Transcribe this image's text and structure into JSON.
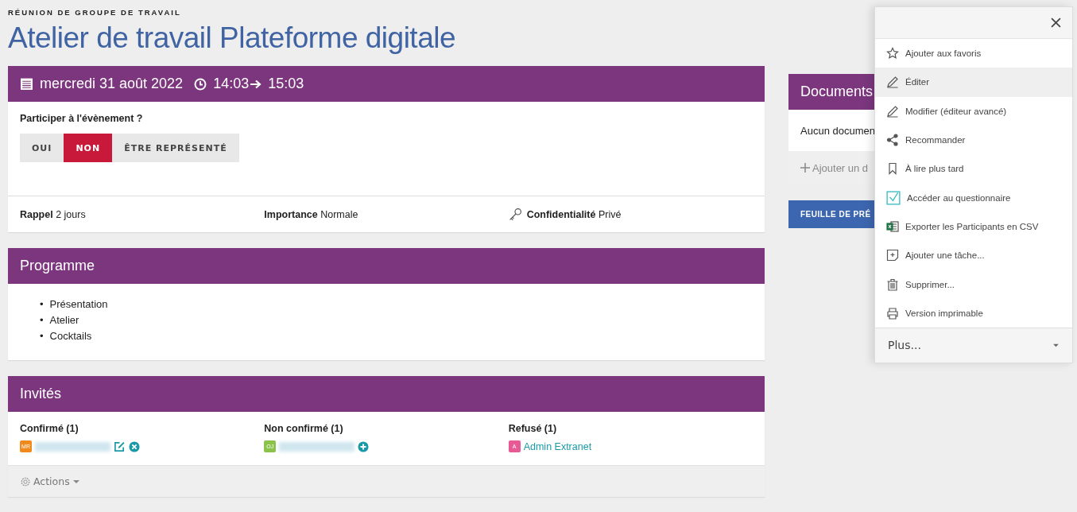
{
  "page": {
    "eyebrow": "RÉUNION DE GROUPE DE TRAVAIL",
    "title": "Atelier de travail Plateforme digitale"
  },
  "event": {
    "date": "mercredi 31 août 2022",
    "start": "14:03",
    "end": "15:03",
    "question": "Participer à l'évènement ?",
    "rsvp": [
      {
        "label": "OUI",
        "selected": false
      },
      {
        "label": "NON",
        "selected": true
      },
      {
        "label": "ÊTRE REPRÉSENTÉ",
        "selected": false
      }
    ],
    "info": [
      {
        "kind": "plain",
        "label": "Rappel",
        "value": "2 jours"
      },
      {
        "kind": "plain",
        "label": "Importance",
        "value": "Normale"
      },
      {
        "kind": "key",
        "label": "Confidentialité",
        "value": "Privé"
      }
    ]
  },
  "programme": {
    "title": "Programme",
    "marker": "•",
    "items": [
      "Présentation",
      "Atelier",
      "Cocktails"
    ]
  },
  "guests": {
    "title": "Invités",
    "columns": [
      {
        "heading": "Confirmé (1)",
        "people": [
          {
            "initials": "MR",
            "color": "#f08a1c",
            "blurred": true,
            "can_edit": true,
            "can_remove": true
          }
        ]
      },
      {
        "heading": "Non confirmé (1)",
        "people": [
          {
            "initials": "OJ",
            "color": "#8bc34a",
            "blurred": true,
            "can_add": true
          }
        ]
      },
      {
        "heading": "Refusé (1)",
        "people": [
          {
            "initials": "A",
            "color": "#e75a95",
            "blurred": false,
            "name": "Admin Extranet"
          }
        ]
      }
    ],
    "footer": "Actions"
  },
  "documents": {
    "title": "Documents",
    "empty": "Aucun documen",
    "add": "Ajouter un d",
    "button": "FEUILLE DE PRÉ"
  },
  "menu": {
    "items": [
      {
        "kind": "star",
        "label": "Ajouter aux favoris",
        "selected": false
      },
      {
        "kind": "pencil",
        "label": "Éditer",
        "selected": true
      },
      {
        "kind": "pencil",
        "label": "Modifier (éditeur avancé)",
        "selected": false
      },
      {
        "kind": "share",
        "label": "Recommander",
        "selected": false
      },
      {
        "kind": "bookmark",
        "label": "À lire plus tard",
        "selected": false
      },
      {
        "kind": "checkbox",
        "label": "Accéder au questionnaire",
        "selected": false
      },
      {
        "kind": "excel",
        "label": "Exporter les Participants en CSV",
        "selected": false
      },
      {
        "kind": "task",
        "label": "Ajouter une tâche...",
        "selected": false
      },
      {
        "kind": "trash",
        "label": "Supprimer...",
        "selected": false
      },
      {
        "kind": "print",
        "label": "Version imprimable",
        "selected": false
      }
    ],
    "more": "Plus..."
  }
}
